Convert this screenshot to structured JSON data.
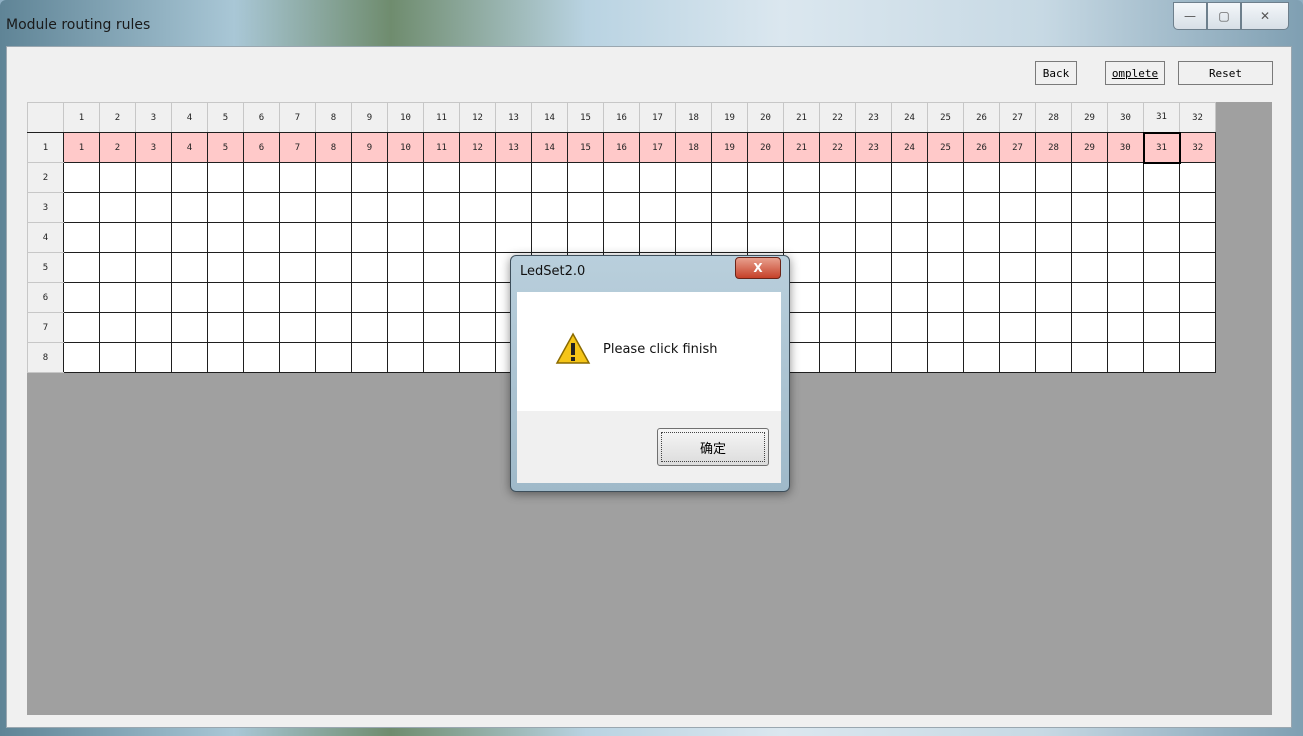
{
  "window": {
    "title": "Module routing rules",
    "controls": {
      "minimize": "—",
      "maximize": "▢",
      "close": "✕"
    }
  },
  "toolbar": {
    "back_label": "Back",
    "complete_label": "omplete",
    "reset_label": "Reset"
  },
  "grid": {
    "columns": [
      "1",
      "2",
      "3",
      "4",
      "5",
      "6",
      "7",
      "8",
      "9",
      "10",
      "11",
      "12",
      "13",
      "14",
      "15",
      "16",
      "17",
      "18",
      "19",
      "20",
      "21",
      "22",
      "23",
      "24",
      "25",
      "26",
      "27",
      "28",
      "29",
      "30",
      "31",
      "32"
    ],
    "rows": [
      "1",
      "2",
      "3",
      "4",
      "5",
      "6",
      "7",
      "8"
    ],
    "row1_values": [
      "1",
      "2",
      "3",
      "4",
      "5",
      "6",
      "7",
      "8",
      "9",
      "10",
      "11",
      "12",
      "13",
      "14",
      "15",
      "16",
      "17",
      "18",
      "19",
      "20",
      "21",
      "22",
      "23",
      "24",
      "25",
      "26",
      "27",
      "28",
      "29",
      "30",
      "31",
      "32"
    ],
    "selected_cell": {
      "row": "1",
      "column": "31"
    },
    "colors": {
      "filled": "#ffc9c9",
      "empty": "#ffffff",
      "background": "#a0a0a0"
    }
  },
  "dialog": {
    "title": "LedSet2.0",
    "close": "X",
    "icon": "warning-icon",
    "message": "Please click finish",
    "ok_label": "确定"
  }
}
